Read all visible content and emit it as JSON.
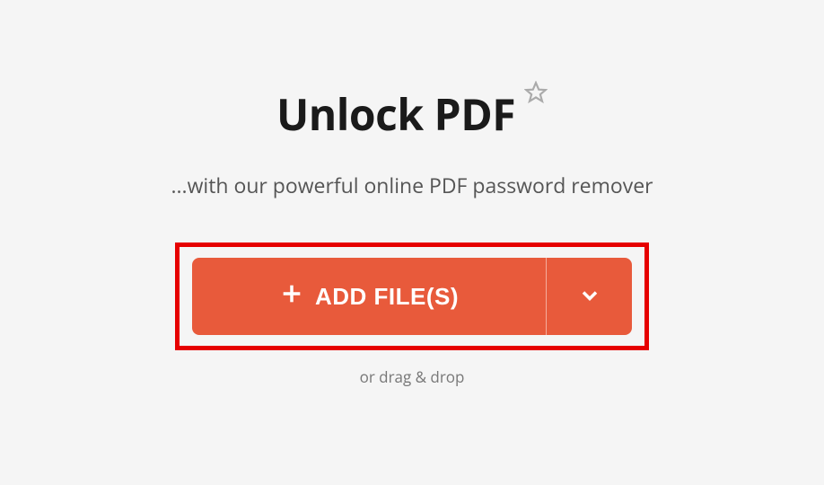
{
  "header": {
    "title": "Unlock PDF",
    "subtitle": "...with our powerful online PDF password remover"
  },
  "upload": {
    "add_button_label": "ADD FILE(S)",
    "drag_drop_text": "or drag & drop"
  }
}
